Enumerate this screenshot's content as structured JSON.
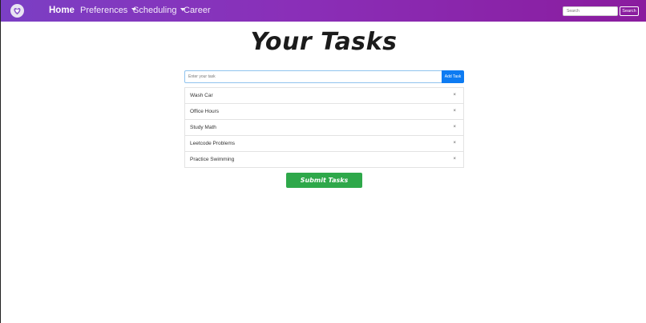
{
  "navbar": {
    "logo_icon": "heart-logo-icon",
    "links": {
      "home": "Home",
      "preferences": "Preferences",
      "scheduling": "Scheduling",
      "career": "Career"
    },
    "search": {
      "placeholder": "Search",
      "button_label": "Search"
    },
    "gradient_colors": [
      "#7b3fc4",
      "#8a1c9e"
    ]
  },
  "main": {
    "title": "Your Tasks",
    "task_input": {
      "placeholder": "Enter your task",
      "value": ""
    },
    "add_button_label": "Add Task",
    "tasks": [
      {
        "label": "Wash Car",
        "remove": "×"
      },
      {
        "label": "Office Hours",
        "remove": "×"
      },
      {
        "label": "Study Math",
        "remove": "×"
      },
      {
        "label": "Leetcode Problems",
        "remove": "×"
      },
      {
        "label": "Practice Swimming",
        "remove": "×"
      }
    ],
    "submit_label": "Submit Tasks",
    "colors": {
      "add_button": "#0d7bf2",
      "submit_button": "#2ea84a"
    }
  }
}
